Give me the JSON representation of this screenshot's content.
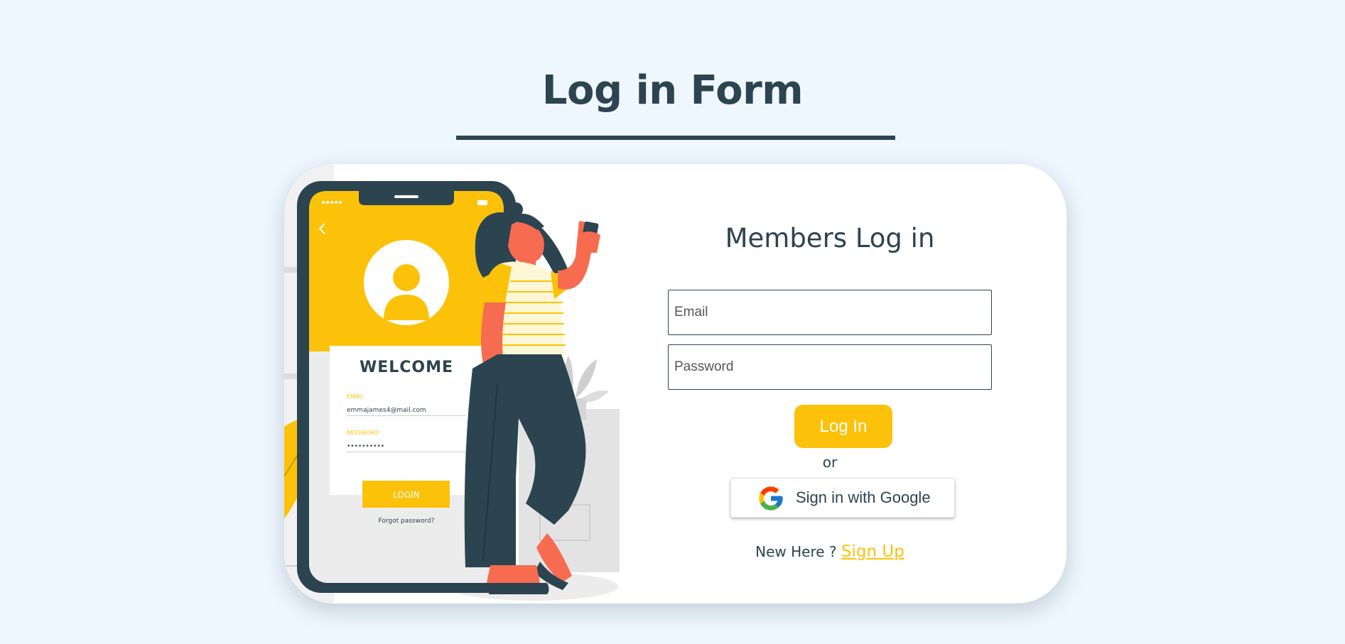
{
  "page": {
    "title": "Log in Form"
  },
  "form": {
    "heading": "Members Log in",
    "email_placeholder": "Email",
    "password_placeholder": "Password",
    "login_label": "Log In",
    "or_label": "or",
    "google_label": "Sign in with Google",
    "new_here_label": "New Here ?",
    "signup_label": "Sign Up"
  },
  "illustration": {
    "welcome": "WELCOME",
    "email_label": "EMAIL",
    "email_value": "emmajames4@mail.com",
    "password_label": "PASSWORD",
    "password_value": "••••••••••",
    "login_label": "LOGIN",
    "forgot_label": "Forgot password?"
  },
  "colors": {
    "background": "#eef6fe",
    "primary_dark": "#2b4450",
    "accent_yellow": "#fcc20a",
    "skin_coral": "#f76b50",
    "card": "#ffffff"
  }
}
